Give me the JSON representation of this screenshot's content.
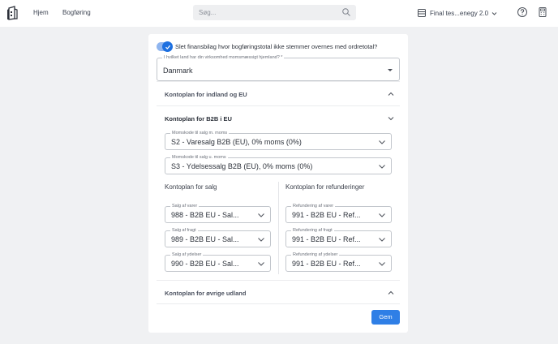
{
  "header": {
    "nav": [
      "Hjem",
      "Bogføring"
    ],
    "search": {
      "placeholder": "Søg..."
    },
    "company": "Final tes...enegy 2.0"
  },
  "form": {
    "toggle": {
      "label": "Slet finansbilag hvor bogføringstotal ikke stemmer overnes med ordretotal?",
      "checked": true
    },
    "country": {
      "label": "I hvilket land har din virksomhed momsmæssigt hjemland?",
      "value": "Danmark"
    },
    "sections": {
      "domestic_eu": "Kontoplan for indland og EU",
      "b2b_eu": "Kontoplan for B2B i EU",
      "other_abroad": "Kontoplan for øvrige udland"
    },
    "vat_with": {
      "label": "Momskode til salg m. moms",
      "value": "S2 - Varesalg B2B (EU), 0% moms (0%)"
    },
    "vat_without": {
      "label": "Momskode til salg u. moms",
      "value": "S3 - Ydelsessalg B2B (EU), 0% moms (0%)"
    },
    "sales": {
      "title": "Kontoplan for salg",
      "fields": [
        {
          "label": "Salg af varer",
          "value": "988 - B2B EU - Sal..."
        },
        {
          "label": "Salg af fragt",
          "value": "989 - B2B EU - Sal..."
        },
        {
          "label": "Salg af ydelser",
          "value": "990 - B2B EU - Sal..."
        }
      ]
    },
    "refunds": {
      "title": "Kontoplan for refunderinger",
      "fields": [
        {
          "label": "Refundering af varer",
          "value": "991 - B2B EU - Ref..."
        },
        {
          "label": "Refundering af fragt",
          "value": "991 - B2B EU - Ref..."
        },
        {
          "label": "Refundering af ydelser",
          "value": "991 - B2B EU - Ref..."
        }
      ]
    },
    "save_label": "Gem"
  },
  "colors": {
    "accent": "#2f7fe6",
    "toggle_track": "#8fb5ef",
    "background": "#f0f1f3"
  },
  "icons": [
    "app-logo-icon",
    "search-icon",
    "store-icon",
    "chevron-down-icon",
    "help-icon",
    "calculator-icon",
    "check-icon",
    "chevron-up-icon"
  ]
}
